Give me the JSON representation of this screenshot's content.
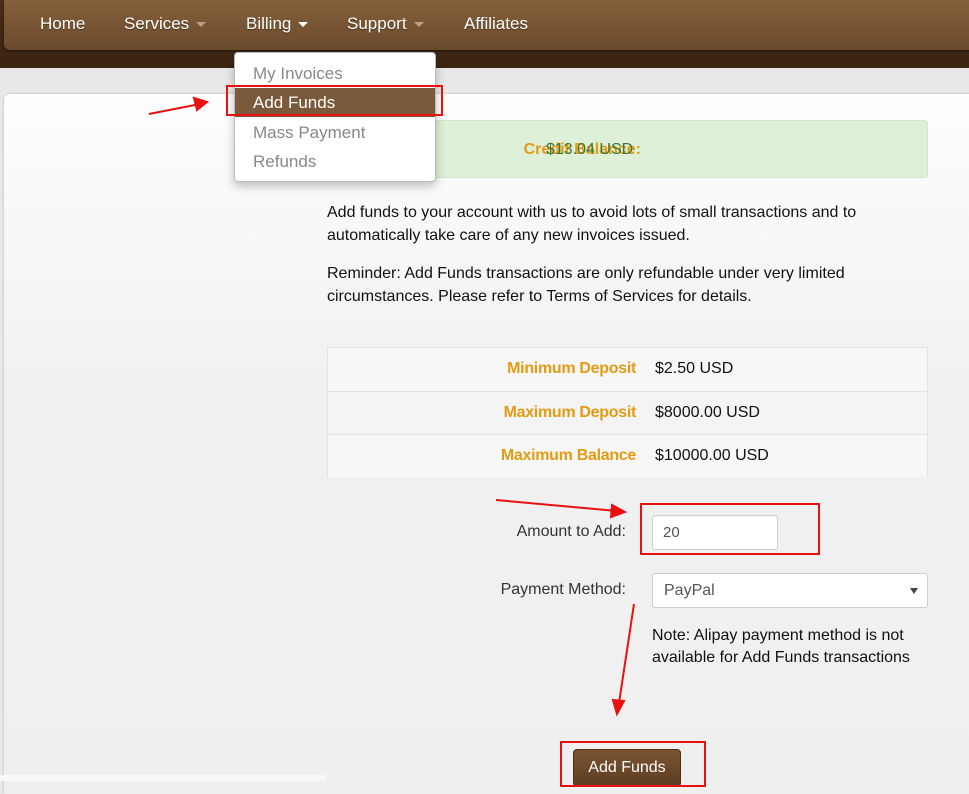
{
  "nav": {
    "items": [
      {
        "label": "Home"
      },
      {
        "label": "Services"
      },
      {
        "label": "Billing"
      },
      {
        "label": "Support"
      },
      {
        "label": "Affiliates"
      }
    ]
  },
  "billing_menu": {
    "items": [
      {
        "label": "My Invoices"
      },
      {
        "label": "Add Funds",
        "active": true
      },
      {
        "label": "Mass Payment"
      },
      {
        "label": "Refunds"
      }
    ]
  },
  "credit": {
    "label": "Credit Balance:",
    "value": "$13.04 USD"
  },
  "intro": "Add funds to your account with us to avoid lots of small transactions and to automatically take care of any new invoices issued.",
  "reminder": "Reminder: Add Funds transactions are only refundable under very limited circumstances. Please refer to Terms of Services for details.",
  "limits": [
    {
      "label": "Minimum Deposit",
      "value": "$2.50 USD"
    },
    {
      "label": "Maximum Deposit",
      "value": "$8000.00 USD"
    },
    {
      "label": "Maximum Balance",
      "value": "$10000.00 USD"
    }
  ],
  "form": {
    "amount_label": "Amount to Add:",
    "amount_value": "20",
    "method_label": "Payment Method:",
    "method_value": "PayPal",
    "note": "Note: Alipay payment method is not available for Add Funds transactions",
    "submit_label": "Add Funds"
  },
  "colors": {
    "nav_brown": "#7a5a3a",
    "label_orange": "#e29b12",
    "annotation_red": "#e81010"
  }
}
